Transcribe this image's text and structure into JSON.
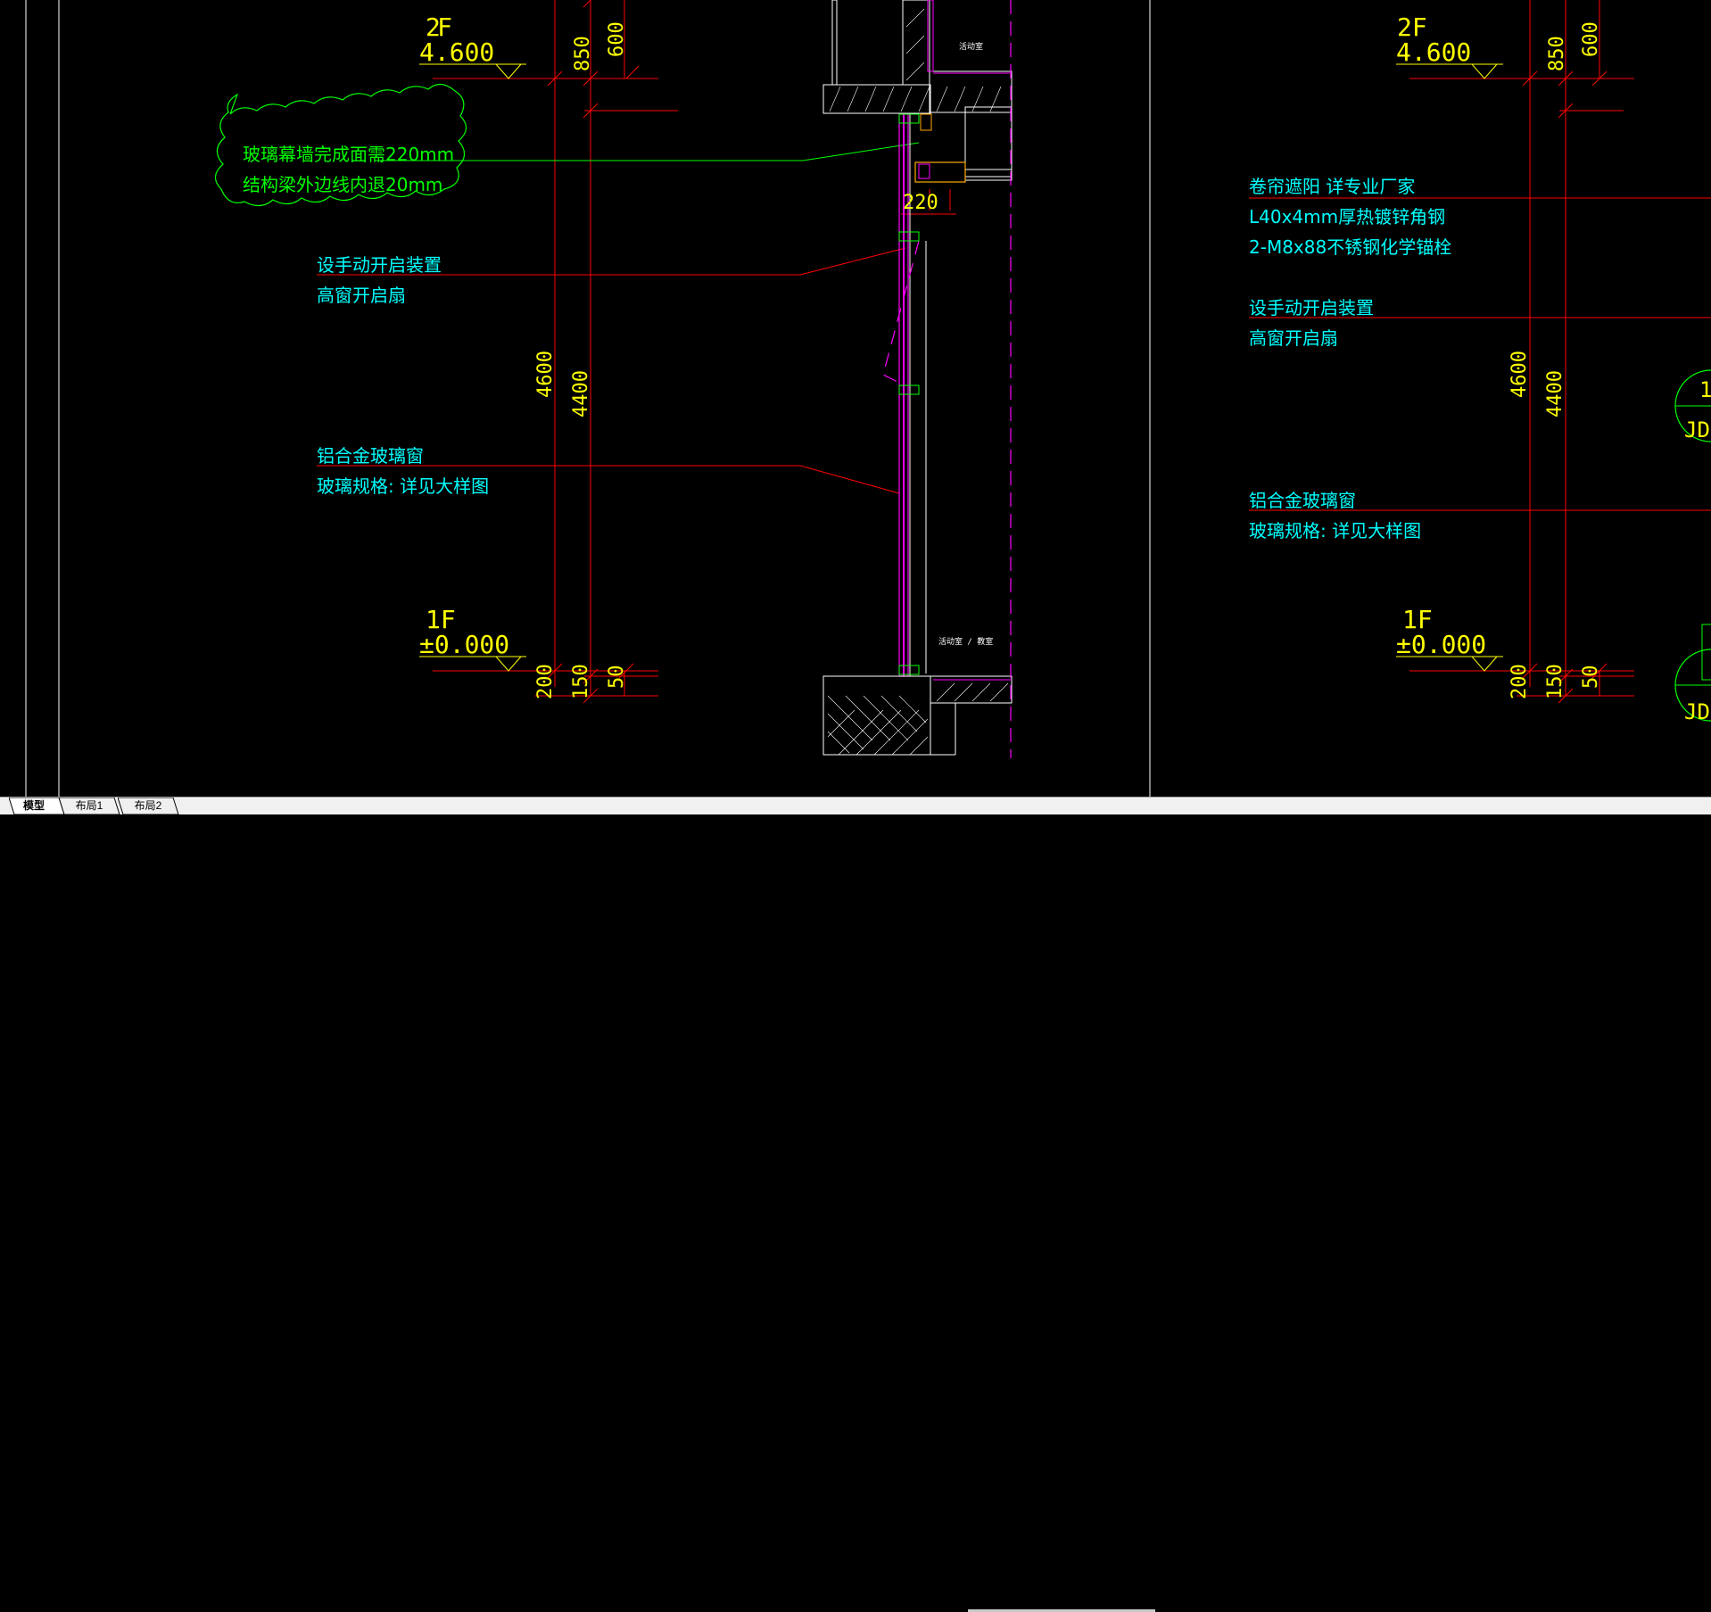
{
  "colors": {
    "background": "#000000",
    "dim_line": "#ff0000",
    "dim_text": "#ffff00",
    "note_text": "#00ffff",
    "cloud": "#00ff00",
    "glass": "#ff00ff",
    "structure": "#ffffff",
    "tab_bar": "#f0f0f0"
  },
  "tabs": [
    {
      "label": "模型",
      "active": true
    },
    {
      "label": "布局1",
      "active": false
    },
    {
      "label": "布局2",
      "active": false
    }
  ],
  "left_view": {
    "level_2f": {
      "name": "2F",
      "elev": "4.600"
    },
    "level_1f": {
      "name": "1F",
      "elev": "±0.000"
    },
    "dims": {
      "d850": "850",
      "d600": "600",
      "d4600": "4600",
      "d4400": "4400",
      "d200": "200",
      "d150": "150",
      "d50": "50",
      "d220": "220"
    },
    "cloud_note": {
      "line1": "玻璃幕墙完成面需220mm",
      "line2": "结构梁外边线内退20mm"
    },
    "note_handle": {
      "line1": "设手动开启装置",
      "line2": "高窗开启扇"
    },
    "note_window": {
      "line1": "铝合金玻璃窗",
      "line2": "玻璃规格: 详见大样图"
    },
    "room_upper": "活动室",
    "room_lower": "活动室 / 教室"
  },
  "right_view": {
    "level_2f": {
      "name": "2F",
      "elev": "4.600"
    },
    "level_1f": {
      "name": "1F",
      "elev": "±0.000"
    },
    "dims": {
      "d850": "850",
      "d600": "600",
      "d4600": "4600",
      "d4400": "4400",
      "d200": "200",
      "d150": "150",
      "d50": "50"
    },
    "note_blind": {
      "line1": "卷帘遮阳 详专业厂家",
      "line2": "L40x4mm厚热镀锌角钢",
      "line3": "2-M8x88不锈钢化学锚栓"
    },
    "note_handle": {
      "line1": "设手动开启装置",
      "line2": "高窗开启扇"
    },
    "note_window": {
      "line1": "铝合金玻璃窗",
      "line2": "玻璃规格: 详见大样图"
    },
    "callout_top": {
      "num": "1",
      "ref": "JD"
    },
    "callout_bottom": {
      "ref": "JD"
    }
  }
}
